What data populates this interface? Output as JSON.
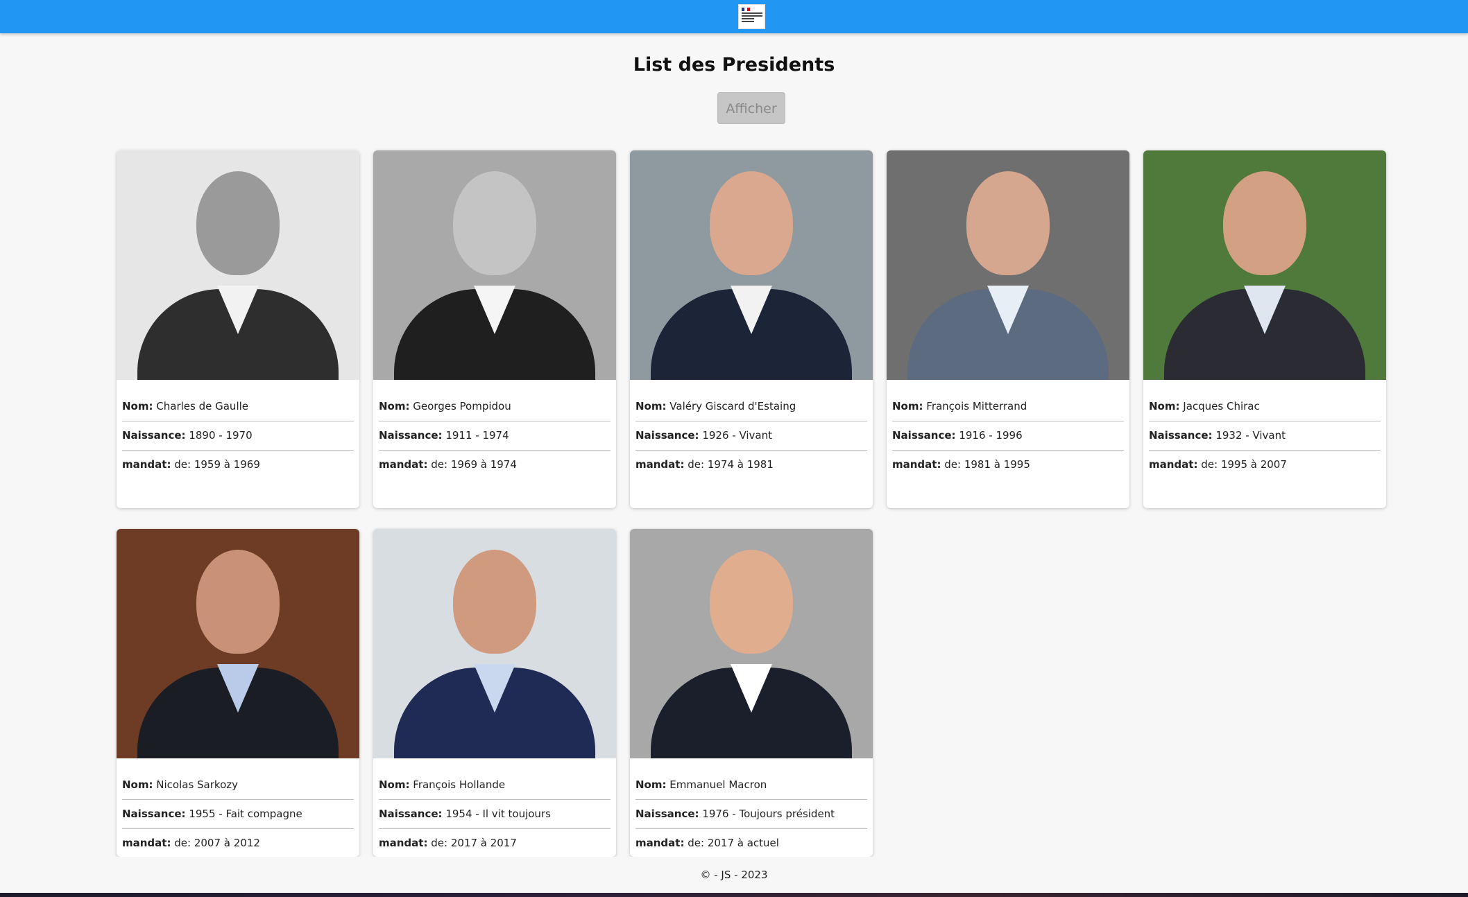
{
  "header": {
    "logo_alt": "République Française"
  },
  "page": {
    "title": "List des Presidents",
    "show_button_label": "Afficher"
  },
  "labels": {
    "nom": "Nom:",
    "naissance": "Naissance:",
    "mandat": "mandat:"
  },
  "presidents": [
    {
      "nom": "Charles de Gaulle",
      "naissance": "1890 - 1970",
      "mandat": "de: 1959 à 1969",
      "photo": "bw"
    },
    {
      "nom": "Georges Pompidou",
      "naissance": "1911 - 1974",
      "mandat": "de: 1969 à 1974",
      "photo": "bw"
    },
    {
      "nom": "Valéry Giscard d'Estaing",
      "naissance": "1926 - Vivant",
      "mandat": "de: 1974 à 1981",
      "photo": "color"
    },
    {
      "nom": "François Mitterrand",
      "naissance": "1916 - 1996",
      "mandat": "de: 1981 à 1995",
      "photo": "color"
    },
    {
      "nom": "Jacques Chirac",
      "naissance": "1932 - Vivant",
      "mandat": "de: 1995 à 2007",
      "photo": "color"
    },
    {
      "nom": "Nicolas Sarkozy",
      "naissance": "1955 - Fait compagne",
      "mandat": "de: 2007 à 2012",
      "photo": "color"
    },
    {
      "nom": "François Hollande",
      "naissance": "1954 - Il vit toujours",
      "mandat": "de: 2017 à 2017",
      "photo": "color"
    },
    {
      "nom": "Emmanuel Macron",
      "naissance": "1976 - Toujours président",
      "mandat": "de: 2017 à actuel",
      "photo": "color"
    }
  ],
  "footer": {
    "text": "© - JS - 2023"
  },
  "colors": {
    "topbar": "#2196f3",
    "background": "#f7f7f7",
    "button_bg": "#c6c6c6"
  }
}
